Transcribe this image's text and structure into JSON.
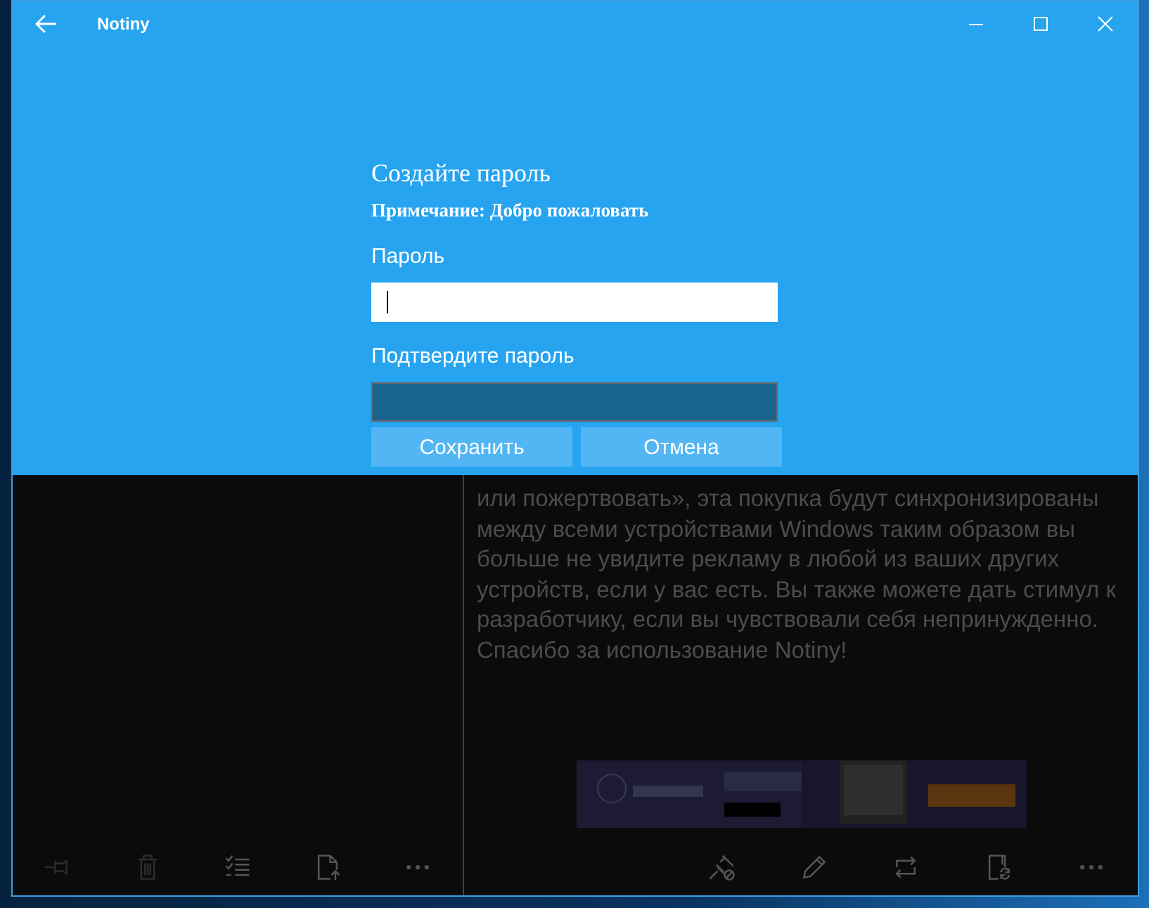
{
  "window": {
    "title": "Notiny"
  },
  "dialog": {
    "title": "Создайте пароль",
    "note": "Примечание: Добро пожаловать",
    "fields": [
      {
        "label": "Пароль",
        "focused": true
      },
      {
        "label": "Подтвердите пароль",
        "focused": false
      }
    ],
    "buttons": [
      "Сохранить",
      "Отмена"
    ]
  },
  "note_text": "или пожертвовать», эта покупка будут синхронизированы между всеми устройствами Windows таким образом вы больше не увидите рекламу в любой из ваших других устройств, если у вас есть. Вы также можете дать стимул к разработчику, если вы чувствовали себя непринужденно. Спасибо за использование Notiny!",
  "left_toolbar": [
    {
      "disabled": true
    },
    {
      "disabled": true
    },
    {
      "disabled": false
    },
    {
      "disabled": false
    },
    {
      "disabled": false
    }
  ],
  "right_toolbar": [
    {
      "disabled": false
    },
    {
      "disabled": false
    },
    {
      "disabled": false
    },
    {
      "disabled": false
    },
    {
      "disabled": false
    }
  ]
}
